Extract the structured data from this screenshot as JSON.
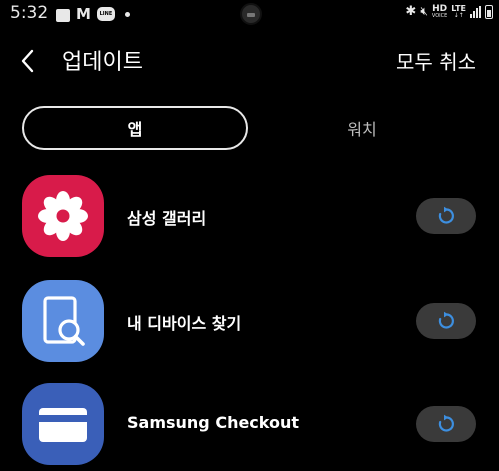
{
  "status_bar": {
    "time": "5:32",
    "gmail_glyph": "M",
    "line_glyph": "LINE",
    "hd": "HD",
    "voice": "VOICE",
    "lte": "LTE",
    "lte_arrows": "↓↑"
  },
  "header": {
    "title": "업데이트",
    "cancel_all": "모두 취소"
  },
  "tabs": [
    {
      "label": "앱",
      "selected": true
    },
    {
      "label": "워치",
      "selected": false
    }
  ],
  "apps": [
    {
      "name": "삼성 갤러리",
      "icon": "gallery-flower-icon",
      "icon_color": "#d81b4a"
    },
    {
      "name": "내 디바이스 찾기",
      "icon": "find-my-device-icon",
      "icon_color": "#5b8de0"
    },
    {
      "name": "Samsung Checkout",
      "icon": "credit-card-icon",
      "icon_color": "#3a5fb8"
    }
  ],
  "colors": {
    "background": "#000000",
    "update_accent": "#3d8fe0",
    "button_bg": "#3a3a3a"
  }
}
